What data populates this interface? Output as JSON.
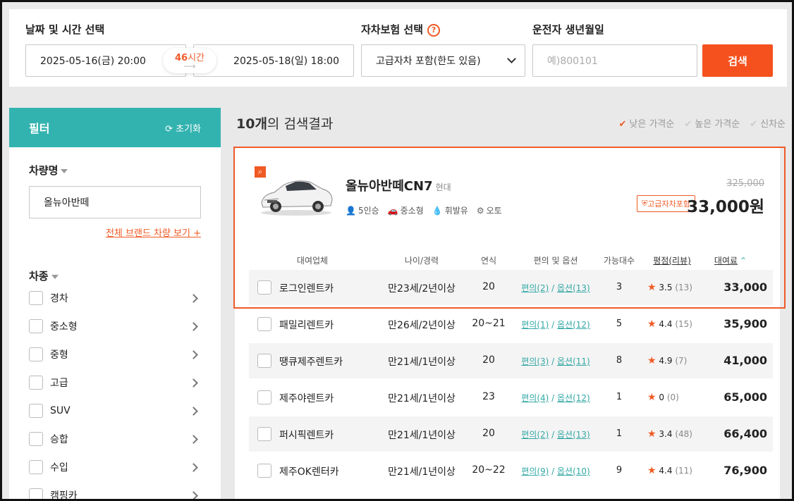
{
  "search": {
    "date_label": "날짜 및 시간 선택",
    "start_date": "2025-05-16(금) 20:00",
    "end_date": "2025-05-18(일) 18:00",
    "duration_num": "46",
    "duration_unit": "시간",
    "insurance_label": "자차보험 선택",
    "insurance_value": "고급자차 포함(한도 있음)",
    "birth_label": "운전자 생년월일",
    "birth_placeholder": "예)800101",
    "search_button": "검색"
  },
  "sidebar": {
    "filter_title": "필터",
    "reset_label": "초기화",
    "car_name_title": "차량명",
    "car_name_value": "올뉴아반떼",
    "brand_link": "전체 브랜드 차량 보기 +",
    "car_type_title": "차종",
    "types": [
      "경차",
      "중소형",
      "중형",
      "고급",
      "SUV",
      "승합",
      "수입",
      "캠핑카"
    ]
  },
  "results": {
    "count": "10개",
    "count_suffix": "의 검색결과",
    "sort_options": [
      "낮은 가격순",
      "높은 가격순",
      "신차순"
    ],
    "sort_active": "낮은 가격순"
  },
  "car": {
    "name": "올뉴아반떼CN7",
    "maker": "현대",
    "specs": [
      "5인승",
      "중소형",
      "휘발유",
      "오토"
    ],
    "original_price": "325,000",
    "price": "33,000원",
    "insurance_badge": "고급자차포함"
  },
  "table": {
    "headers": [
      "대여업체",
      "나이/경력",
      "연식",
      "편의 및 옵션",
      "가능대수",
      "평점(리뷰)",
      "대여료"
    ],
    "rows": [
      {
        "company": "로그인렌트카",
        "age": "만23세/2년이상",
        "year": "20",
        "conv": "편의(2)",
        "opt": "옵션(13)",
        "avail": "3",
        "rating": "3.5",
        "reviews": "(13)",
        "price": "33,000"
      },
      {
        "company": "패밀리렌트카",
        "age": "만26세/2년이상",
        "year": "20~21",
        "conv": "편의(1)",
        "opt": "옵션(12)",
        "avail": "5",
        "rating": "4.4",
        "reviews": "(15)",
        "price": "35,900"
      },
      {
        "company": "땡큐제주렌트카",
        "age": "만21세/1년이상",
        "year": "20",
        "conv": "편의(3)",
        "opt": "옵션(11)",
        "avail": "8",
        "rating": "4.9",
        "reviews": "(7)",
        "price": "41,000"
      },
      {
        "company": "제주야렌트카",
        "age": "만21세/1년이상",
        "year": "23",
        "conv": "편의(4)",
        "opt": "옵션(12)",
        "avail": "1",
        "rating": "0",
        "reviews": "(0)",
        "price": "65,000"
      },
      {
        "company": "퍼시픽렌트카",
        "age": "만21세/1년이상",
        "year": "20",
        "conv": "편의(2)",
        "opt": "옵션(13)",
        "avail": "1",
        "rating": "3.4",
        "reviews": "(48)",
        "price": "66,400"
      },
      {
        "company": "제주OK렌터카",
        "age": "만21세/1년이상",
        "year": "20~22",
        "conv": "편의(9)",
        "opt": "옵션(10)",
        "avail": "9",
        "rating": "4.4",
        "reviews": "(11)",
        "price": "76,900"
      }
    ]
  },
  "colors": {
    "accent": "#f4511e",
    "teal": "#33b3b0"
  }
}
